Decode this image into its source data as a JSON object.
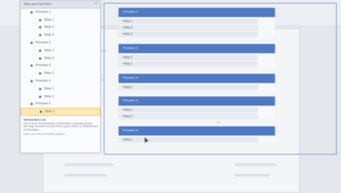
{
  "pane": {
    "title": "Type your text here",
    "close": "×",
    "tree": [
      {
        "label": "Process 1",
        "level": 0
      },
      {
        "label": "Step 1",
        "level": 1
      },
      {
        "label": "Step 2",
        "level": 1
      },
      {
        "label": "Step 3",
        "level": 1
      },
      {
        "label": "Process 2",
        "level": 0
      },
      {
        "label": "Step 1",
        "level": 1
      },
      {
        "label": "Step 2",
        "level": 1
      },
      {
        "label": "Process 3",
        "level": 0
      },
      {
        "label": "Step 1",
        "level": 1
      },
      {
        "label": "Process 4",
        "level": 0
      },
      {
        "label": "Step 1",
        "level": 1
      },
      {
        "label": "Step 2",
        "level": 1
      },
      {
        "label": "Process 5",
        "level": 0
      },
      {
        "label": "Step 1",
        "level": 1
      }
    ],
    "selected_index": 13,
    "footer_title": "Vertical Box List",
    "footer_text": "Use to show several groups of information, especially groups with large amounts of Level 2 text. A good choice for bulleted lists of information.",
    "footer_link": "Learn more about SmartArt graphics"
  },
  "diagram": {
    "groups": [
      {
        "title": "Process 1",
        "steps": [
          "•Step 1",
          "•Step 2",
          "•Step 3"
        ]
      },
      {
        "title": "Process 2",
        "steps": [
          "•Step 1",
          "•Step 2"
        ]
      },
      {
        "title": "Process 3",
        "steps": [
          "•Step 1"
        ]
      },
      {
        "title": "Process 4",
        "steps": [
          "•Step 1",
          "•Step 2"
        ]
      },
      {
        "title": "Process 5",
        "steps": [
          "•Step 1"
        ]
      }
    ]
  }
}
